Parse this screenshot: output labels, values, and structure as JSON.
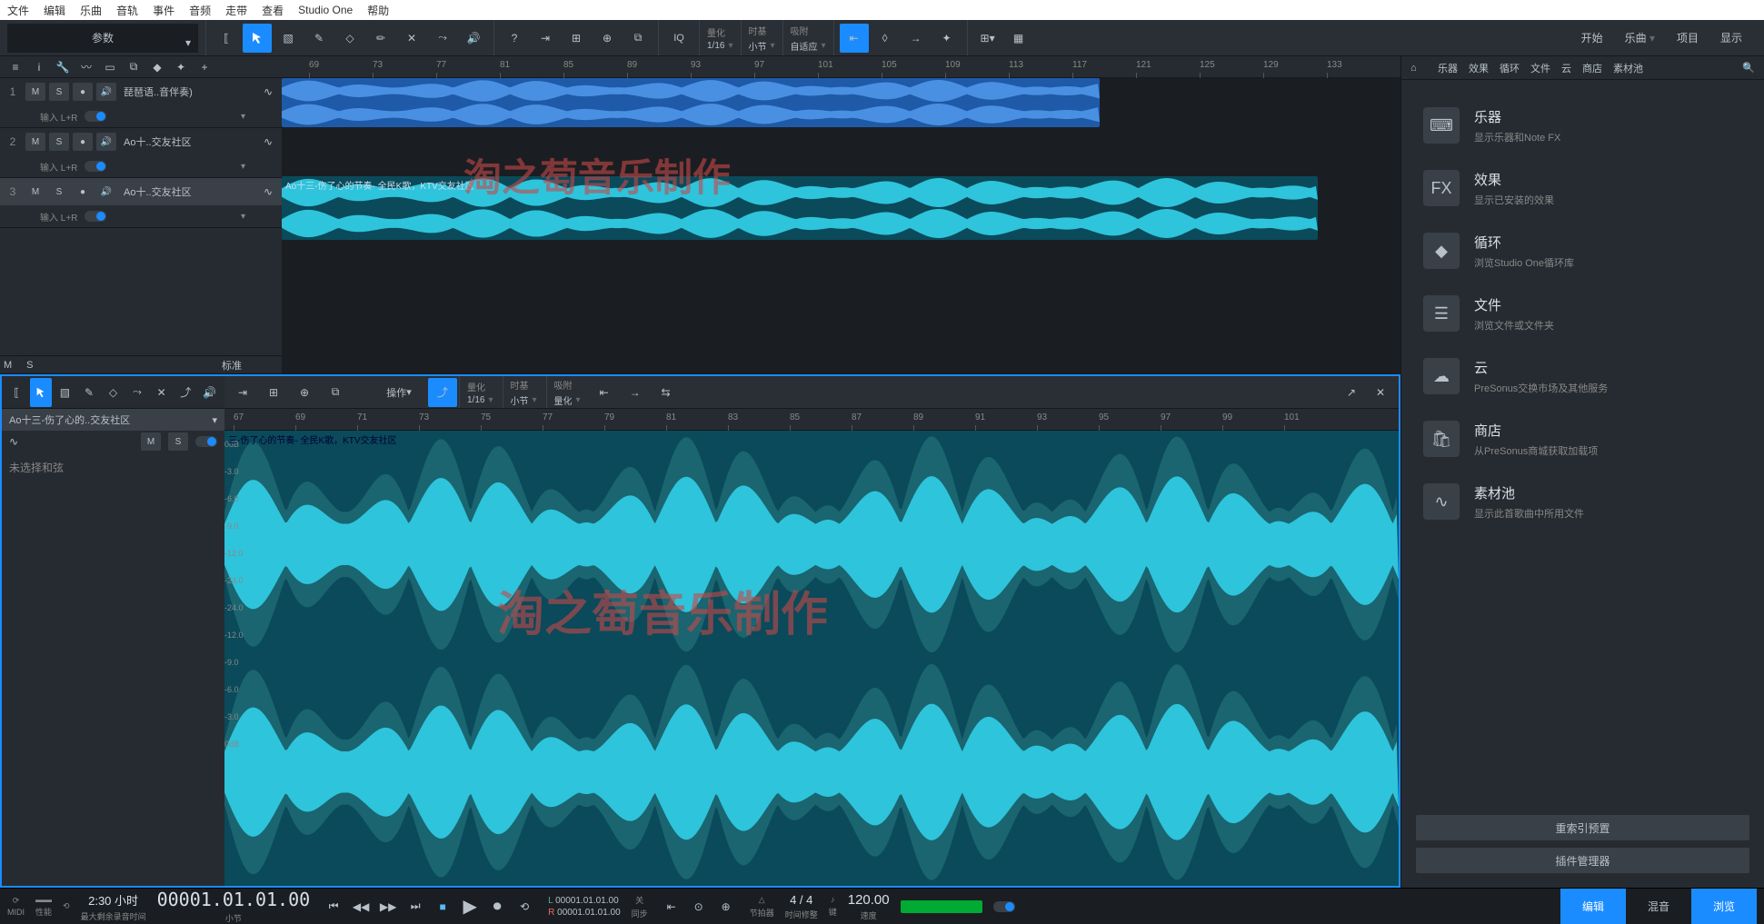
{
  "menubar": [
    "文件",
    "编辑",
    "乐曲",
    "音轨",
    "事件",
    "音频",
    "走带",
    "查看",
    "Studio One",
    "帮助"
  ],
  "param_label": "参数",
  "top_right": {
    "start": "开始",
    "song": "乐曲",
    "project": "项目",
    "show": "显示"
  },
  "quantize": {
    "label": "量化",
    "value": "1/16"
  },
  "timebase": {
    "label": "时基",
    "value": "小节"
  },
  "snap": {
    "label": "吸附",
    "value": "自适应"
  },
  "iq_label": "IQ",
  "tracks": [
    {
      "num": "1",
      "name": "琵琶语..音伴奏)",
      "input": "输入 L+R"
    },
    {
      "num": "2",
      "name": "Ao十..交友社区",
      "input": "输入 L+R"
    },
    {
      "num": "3",
      "name": "Ao十..交友社区",
      "input": "输入 L+R"
    }
  ],
  "ms_bar": {
    "m": "M",
    "s": "S",
    "std": "标准"
  },
  "ruler_marks": [
    "69",
    "73",
    "77",
    "81",
    "85",
    "89",
    "93",
    "97",
    "101",
    "105",
    "109",
    "113",
    "117",
    "121",
    "125",
    "129",
    "133"
  ],
  "clip1_label": "",
  "clip3_label": "Ao十三-伤了心的节奏- 全民K歌，KTV交友社区",
  "watermark": "淘之萄音乐制作",
  "editor": {
    "clip_name": "Ao十三-伤了心的..交友社区",
    "chord": "未选择和弦",
    "op_label": "操作",
    "q_label": "量化",
    "q_val": "1/16",
    "tb_label": "时基",
    "tb_val": "小节",
    "sn_label": "吸附",
    "sn_val": "量化",
    "ruler": [
      "67",
      "69",
      "71",
      "73",
      "75",
      "77",
      "79",
      "81",
      "83",
      "85",
      "87",
      "89",
      "91",
      "93",
      "95",
      "97",
      "99",
      "101"
    ],
    "wave_label": "三-伤了心的节奏- 全民K歌，KTV交友社区",
    "db": [
      "0dB",
      "-3.0",
      "-6.0",
      "-9.0",
      "-12.0",
      "-24.0",
      "-24.0",
      "-12.0",
      "-9.0",
      "-6.0",
      "-3.0",
      "0dB"
    ]
  },
  "browser": {
    "tabs": [
      "乐器",
      "效果",
      "循环",
      "文件",
      "云",
      "商店",
      "素材池"
    ],
    "items": [
      {
        "title": "乐器",
        "desc": "显示乐器和Note FX",
        "icon": "piano"
      },
      {
        "title": "效果",
        "desc": "显示已安装的效果",
        "icon": "fx"
      },
      {
        "title": "循环",
        "desc": "浏览Studio One循环库",
        "icon": "loop"
      },
      {
        "title": "文件",
        "desc": "浏览文件或文件夹",
        "icon": "file"
      },
      {
        "title": "云",
        "desc": "PreSonus交换市场及其他服务",
        "icon": "cloud"
      },
      {
        "title": "商店",
        "desc": "从PreSonus商城获取加载项",
        "icon": "shop"
      },
      {
        "title": "素材池",
        "desc": "显示此首歌曲中所用文件",
        "icon": "pool"
      }
    ],
    "btn1": "重索引预置",
    "btn2": "插件管理器"
  },
  "transport": {
    "midi": "MIDI",
    "perf": "性能",
    "time": "2:30 小时",
    "time_sub": "最大剩余录音时间",
    "pos": "00001.01.01.00",
    "pos_sub": "小节",
    "L": "00001.01.01.00",
    "R": "00001.01.01.00",
    "sync": "同步",
    "sync_val": "关",
    "metro": "节拍器",
    "tc": "时间修整",
    "key": "键",
    "sig": "4 / 4",
    "tempo": "120.00",
    "tempo_sub": "速度",
    "edit": "编辑",
    "mix": "混音",
    "browse": "浏览"
  }
}
